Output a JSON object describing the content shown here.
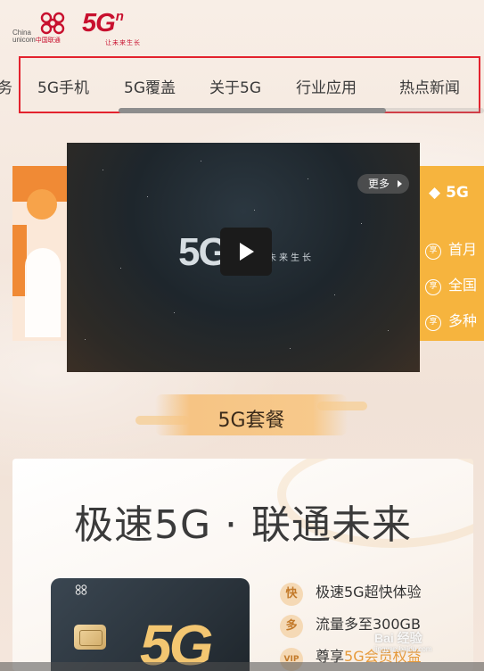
{
  "header": {
    "logo_en_1": "China",
    "logo_en_2": "unicom",
    "logo_cn": "中国联通",
    "logo_5g": "5G",
    "logo_sup": "n",
    "logo_slogan": "让未来生长",
    "brand_color": "#c8102e"
  },
  "nav": {
    "partial_left": "务",
    "items": [
      "5G手机",
      "5G覆盖",
      "关于5G",
      "行业应用",
      "热点新闻"
    ],
    "highlight_color": "#e3222e"
  },
  "carousel": {
    "video": {
      "logo": "5G",
      "slogan": "让未来生长",
      "more_label": "更多",
      "play_icon": "play-icon"
    },
    "right_card": {
      "title": "5G",
      "features": [
        {
          "badge": "享",
          "text": "首月"
        },
        {
          "badge": "享",
          "text": "全国"
        },
        {
          "badge": "享",
          "text": "多种"
        }
      ]
    }
  },
  "package": {
    "section_title": "5G套餐",
    "headline": "极速5G · 联通未来",
    "card_logo": "5G",
    "features": [
      {
        "icon": "快",
        "text": "极速5G超快体验",
        "highlight": ""
      },
      {
        "icon": "多",
        "text": "流量多至300GB",
        "highlight": ""
      },
      {
        "icon": "VIP",
        "text": "尊享",
        "highlight": "5G会员权益"
      }
    ]
  },
  "watermark": {
    "text": "Bai 经验",
    "sub": "jingyan.baidu.com"
  }
}
